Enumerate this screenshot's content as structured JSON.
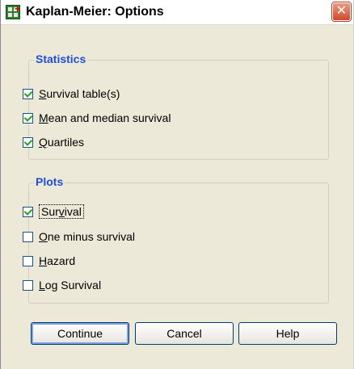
{
  "window": {
    "title": "Kaplan-Meier: Options",
    "close_glyph": "✕"
  },
  "statistics": {
    "label": "Statistics",
    "items": [
      {
        "label": "Survival table(s)",
        "mnemonic": "S",
        "rest": "urvival table(s)",
        "checked": true
      },
      {
        "label": "Mean and median survival",
        "mnemonic": "M",
        "rest": "ean and median survival",
        "checked": true
      },
      {
        "label": "Quartiles",
        "mnemonic": "Q",
        "rest": "uartiles",
        "checked": true
      }
    ]
  },
  "plots": {
    "label": "Plots",
    "items": [
      {
        "label": "Survival",
        "prefix": "Sur",
        "mnemonic": "v",
        "rest": "ival",
        "checked": true,
        "focused": true
      },
      {
        "label": "One minus survival",
        "prefix": "",
        "mnemonic": "O",
        "rest": "ne minus survival",
        "checked": false
      },
      {
        "label": "Hazard",
        "prefix": "",
        "mnemonic": "H",
        "rest": "azard",
        "checked": false
      },
      {
        "label": "Log Survival",
        "prefix": "",
        "mnemonic": "L",
        "rest": "og Survival",
        "checked": false
      }
    ]
  },
  "buttons": {
    "continue": "Continue",
    "cancel": "Cancel",
    "help": "Help"
  },
  "colors": {
    "group_title": "#1d4fd8",
    "dialog_bg": "#ece9d8",
    "check_mark": "#21a121"
  },
  "icons": {
    "app": "spss-grid-icon",
    "close": "close-icon"
  }
}
